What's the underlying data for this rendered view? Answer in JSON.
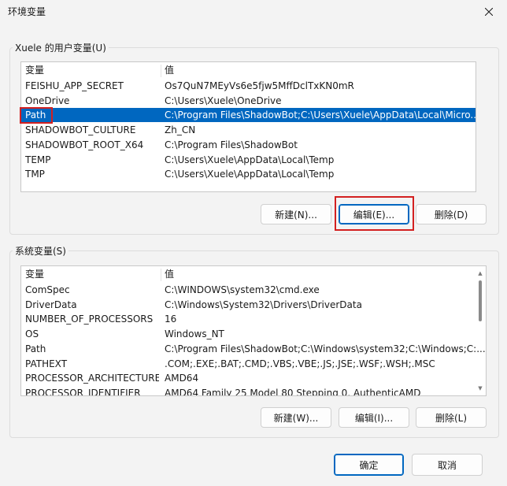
{
  "window": {
    "title": "环境变量"
  },
  "user_section": {
    "label": "Xuele 的用户变量(U)",
    "columns": [
      "变量",
      "值"
    ],
    "rows": [
      {
        "var": "FEISHU_APP_SECRET",
        "val": "Os7QuN7MEyVs6e5fjw5MffDclTxKN0mR"
      },
      {
        "var": "OneDrive",
        "val": "C:\\Users\\Xuele\\OneDrive"
      },
      {
        "var": "Path",
        "val": "C:\\Program Files\\ShadowBot;C:\\Users\\Xuele\\AppData\\Local\\Micro..."
      },
      {
        "var": "SHADOWBOT_CULTURE",
        "val": "Zh_CN"
      },
      {
        "var": "SHADOWBOT_ROOT_X64",
        "val": "C:\\Program Files\\ShadowBot"
      },
      {
        "var": "TEMP",
        "val": "C:\\Users\\Xuele\\AppData\\Local\\Temp"
      },
      {
        "var": "TMP",
        "val": "C:\\Users\\Xuele\\AppData\\Local\\Temp"
      }
    ],
    "selected_var": "Path",
    "buttons": {
      "new": "新建(N)...",
      "edit": "编辑(E)...",
      "delete": "删除(D)"
    }
  },
  "system_section": {
    "label": "系统变量(S)",
    "columns": [
      "变量",
      "值"
    ],
    "rows": [
      {
        "var": "ComSpec",
        "val": "C:\\WINDOWS\\system32\\cmd.exe"
      },
      {
        "var": "DriverData",
        "val": "C:\\Windows\\System32\\Drivers\\DriverData"
      },
      {
        "var": "NUMBER_OF_PROCESSORS",
        "val": "16"
      },
      {
        "var": "OS",
        "val": "Windows_NT"
      },
      {
        "var": "Path",
        "val": "C:\\Program Files\\ShadowBot;C:\\Windows\\system32;C:\\Windows;C:..."
      },
      {
        "var": "PATHEXT",
        "val": ".COM;.EXE;.BAT;.CMD;.VBS;.VBE;.JS;.JSE;.WSF;.WSH;.MSC"
      },
      {
        "var": "PROCESSOR_ARCHITECTURE",
        "val": "AMD64"
      },
      {
        "var": "PROCESSOR_IDENTIFIER",
        "val": "AMD64 Family 25 Model 80 Stepping 0, AuthenticAMD"
      }
    ],
    "buttons": {
      "new": "新建(W)...",
      "edit": "编辑(I)...",
      "delete": "删除(L)"
    }
  },
  "footer": {
    "ok": "确定",
    "cancel": "取消"
  },
  "colors": {
    "selection": "#0067c0",
    "highlight_box": "#d32020"
  }
}
